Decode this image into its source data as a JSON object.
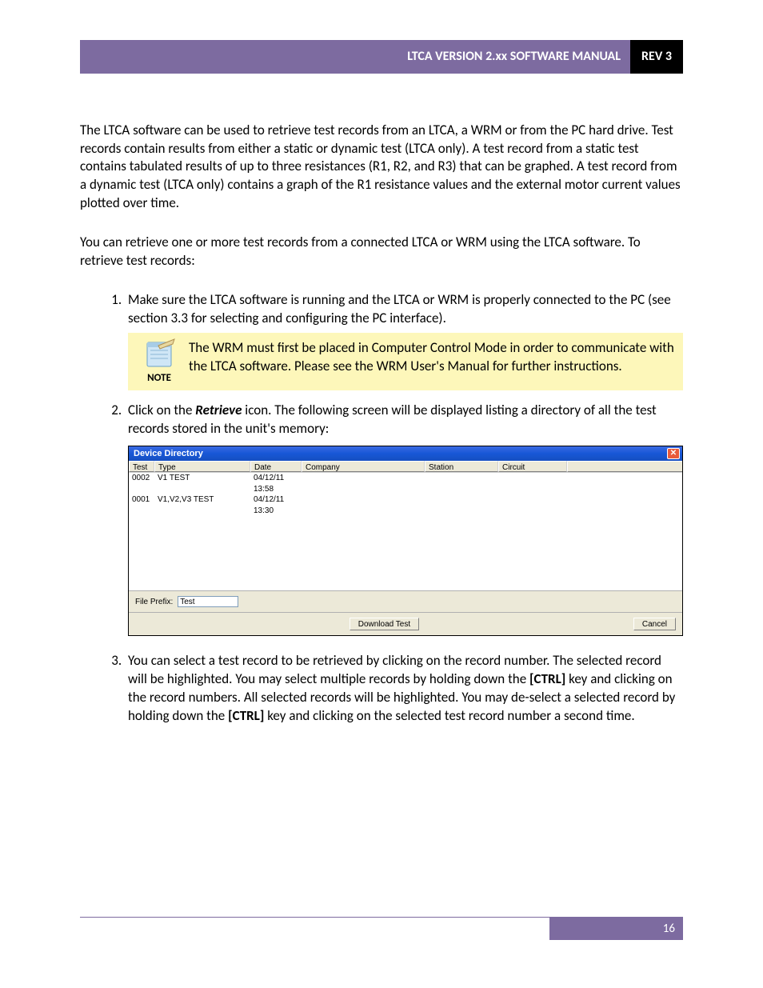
{
  "header": {
    "title": "LTCA VERSION 2.xx SOFTWARE MANUAL",
    "rev": "REV 3"
  },
  "paragraphs": {
    "p1": "The LTCA software can be used to retrieve test records from an LTCA, a WRM or from the PC hard drive. Test records contain results from either a static or dynamic test (LTCA only). A test record from a static test contains tabulated results of up to three resistances (R1, R2, and R3) that can be graphed. A test record from a dynamic test (LTCA only) contains a graph of the R1 resistance values and the external motor current values plotted over time.",
    "p2": "You can retrieve one or more test records from a connected LTCA or WRM using the LTCA software. To retrieve test records:"
  },
  "steps": {
    "s1": "Make sure the LTCA software is running and the LTCA or WRM is properly connected to the PC (see section 3.3 for selecting and configuring the PC interface).",
    "s2a": "Click on the ",
    "s2b": "Retrieve",
    "s2c": " icon. The following screen will be displayed listing a directory of all the test records stored in the unit's memory:",
    "s3a": "You can select a test record to be retrieved by clicking on the record number. The selected record will be highlighted. You may select multiple records by holding down the ",
    "s3b": "[CTRL]",
    "s3c": " key and clicking on the record numbers. All selected records will be highlighted. You may de-select a selected record by holding down the ",
    "s3d": "[CTRL]",
    "s3e": " key and clicking on the selected test record number a second time."
  },
  "note": {
    "label": "NOTE",
    "text": "The WRM must first be placed in Computer Control Mode in order to communicate with the LTCA software. Please see the WRM User's Manual for further instructions."
  },
  "dialog": {
    "title": "Device Directory",
    "columns": {
      "test": "Test",
      "type": "Type",
      "date": "Date",
      "company": "Company",
      "station": "Station",
      "circuit": "Circuit"
    },
    "rows": [
      {
        "test": "0002",
        "type": "V1 TEST",
        "date": "04/12/11 13:58"
      },
      {
        "test": "0001",
        "type": "V1,V2,V3 TEST",
        "date": "04/12/11 13:30"
      }
    ],
    "filePrefixLabel": "File Prefix:",
    "filePrefixValue": "Test",
    "downloadBtn": "Download Test",
    "cancelBtn": "Cancel"
  },
  "footer": {
    "page": "16"
  }
}
